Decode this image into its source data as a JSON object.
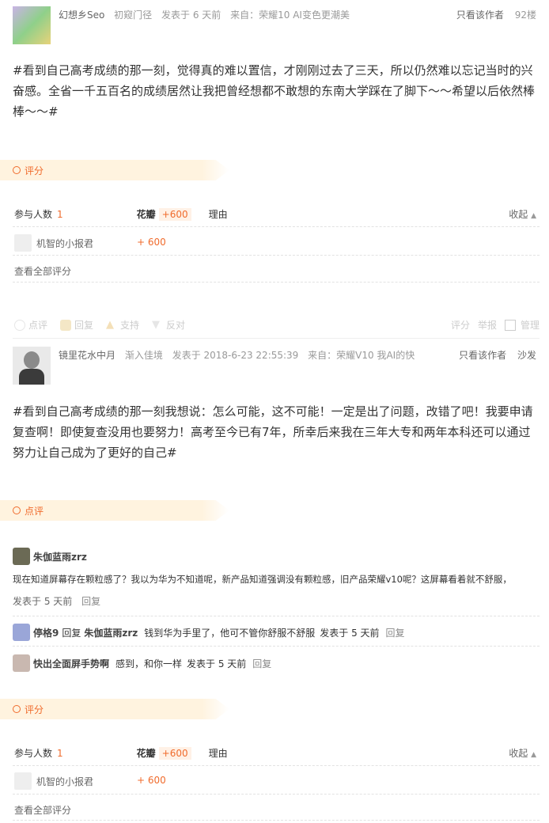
{
  "post1": {
    "author": "幻想乡Seo",
    "level": "初窥门径",
    "posted": "发表于 6 天前",
    "source": "来自：荣耀10 AI变色更潮美",
    "only_author": "只看该作者",
    "floor": "92楼",
    "content": "#看到自己高考成绩的那一刻，觉得真的难以置信，才刚刚过去了三天，所以仍然难以忘记当时的兴奋感。全省一千五百名的成绩居然让我把曾经想都不敢想的东南大学踩在了脚下～～希望以后依然棒棒～～#"
  },
  "rating1": {
    "tag": "评分",
    "participants_label": "参与人数",
    "participants_count": "1",
    "flower_label": "花瓣",
    "flower_value": "+600",
    "reason_label": "理由",
    "collapse_label": "收起",
    "rater_name": "机智的小报君",
    "rater_value": "+ 600",
    "view_all": "查看全部评分"
  },
  "actions": {
    "comment": "点评",
    "reply": "回复",
    "support": "支持",
    "oppose": "反对",
    "rate": "评分",
    "report": "举报",
    "manage": "管理"
  },
  "post2": {
    "author": "镜里花水中月",
    "level": "渐入佳境",
    "posted": "发表于 2018-6-23 22:55:39",
    "source": "来自：荣耀V10 我AI的快",
    "only_author": "只看该作者",
    "floor": "沙发",
    "content": "#看到自己高考成绩的那一刻我想说：怎么可能，这不可能！一定是出了问题，改错了吧！我要申请复查啊！即使复查没用也要努力！高考至今已有7年，所幸后来我在三年大专和两年本科还可以通过努力让自己成为了更好的自己#"
  },
  "review": {
    "tag": "点评",
    "c1_author": "朱伽蓝雨zrz",
    "c1_text": "现在知道屏幕存在颗粒感了？我以为华为不知道呢，新产品知道强调没有颗粒感，旧产品荣耀v10呢？这屏幕看着就不舒服，",
    "c1_time": "发表于 5 天前",
    "c1_reply": "回复",
    "c2_author": "停格9",
    "c2_reply_word": "回复",
    "c2_target": "朱伽蓝雨zrz",
    "c2_text": "钱到华为手里了，他可不管你舒服不舒服",
    "c2_time": "发表于 5 天前",
    "c2_reply": "回复",
    "c3_author": "快出全面屏手势啊",
    "c3_text": "感到，和你一样",
    "c3_time": "发表于 5 天前",
    "c3_reply": "回复"
  },
  "rating2": {
    "tag": "评分",
    "participants_label": "参与人数",
    "participants_count": "1",
    "flower_label": "花瓣",
    "flower_value": "+600",
    "reason_label": "理由",
    "collapse_label": "收起",
    "rater_name": "机智的小报君",
    "rater_value": "+ 600",
    "view_all": "查看全部评分"
  },
  "colors": {
    "accent": "#f06b2c",
    "tag_bg": "#fff3df"
  }
}
